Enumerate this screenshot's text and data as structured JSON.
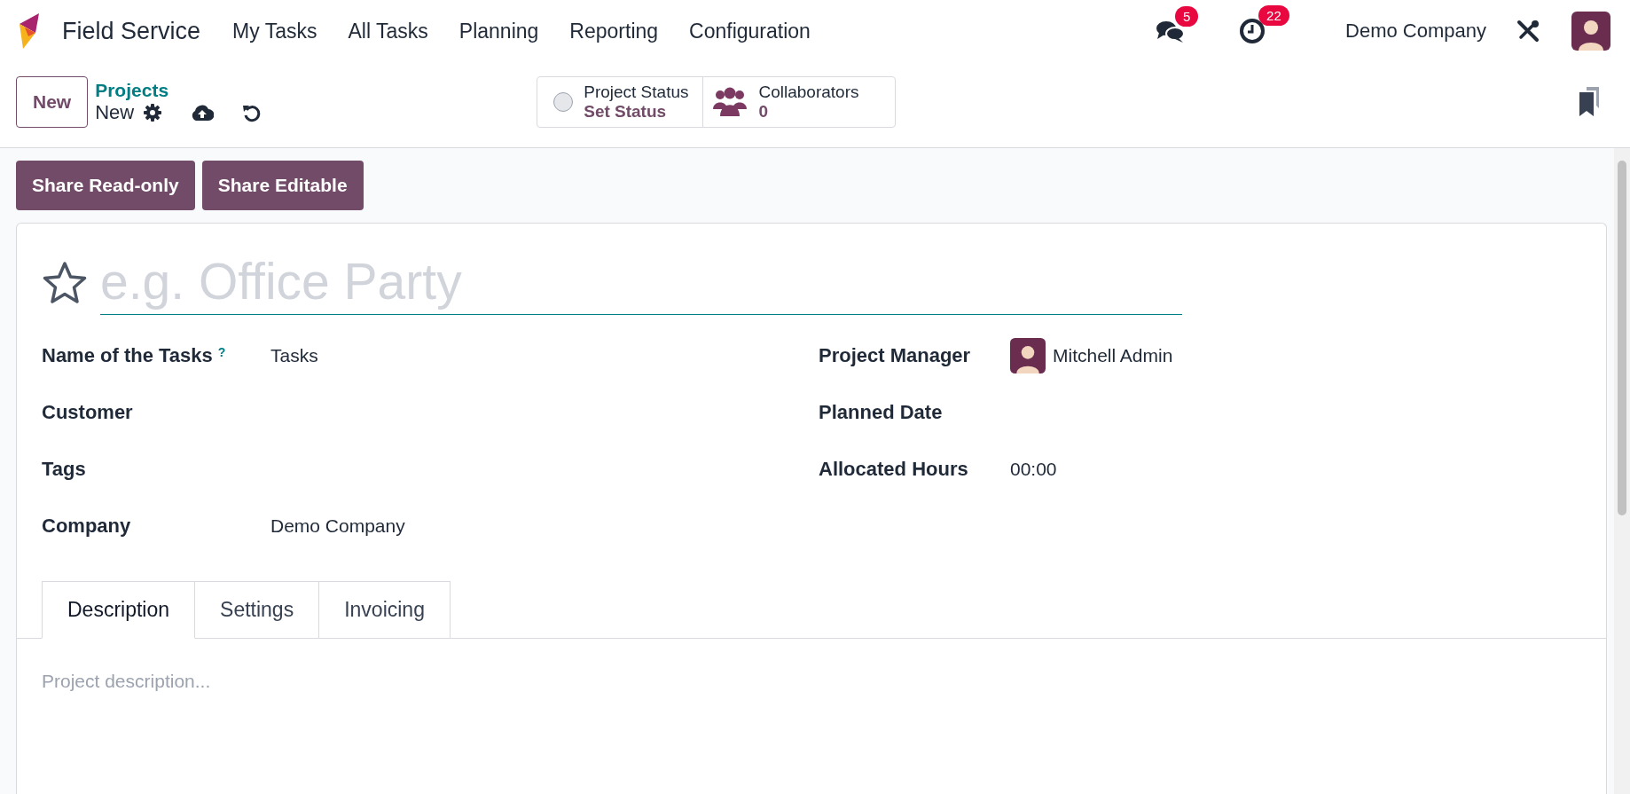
{
  "navbar": {
    "app_name": "Field Service",
    "menu": [
      "My Tasks",
      "All Tasks",
      "Planning",
      "Reporting",
      "Configuration"
    ],
    "messages_count": "5",
    "activities_count": "22",
    "company": "Demo Company"
  },
  "control_panel": {
    "new_button": "New",
    "breadcrumb": "Projects",
    "record": "New",
    "status": {
      "label": "Project Status",
      "value": "Set Status"
    },
    "collaborators": {
      "label": "Collaborators",
      "count": "0"
    }
  },
  "actions": [
    "Share Read-only",
    "Share Editable"
  ],
  "form": {
    "name_placeholder": "e.g. Office Party",
    "favorite": false,
    "left_fields": [
      {
        "label": "Name of the Tasks",
        "help": "?",
        "value": "Tasks"
      },
      {
        "label": "Customer"
      },
      {
        "label": "Tags"
      },
      {
        "label": "Company",
        "value": "Demo Company"
      }
    ],
    "right_fields": [
      {
        "label": "Project Manager",
        "value": "Mitchell Admin",
        "kind": "user"
      },
      {
        "label": "Planned Date",
        "kind": "text"
      },
      {
        "label": "Allocated Hours",
        "value": "00:00",
        "kind": "text"
      }
    ],
    "tabs": [
      {
        "label": "Description",
        "selected": true
      },
      {
        "label": "Settings",
        "selected": false
      },
      {
        "label": "Invoicing",
        "selected": false
      }
    ],
    "description_placeholder": "Project description..."
  }
}
